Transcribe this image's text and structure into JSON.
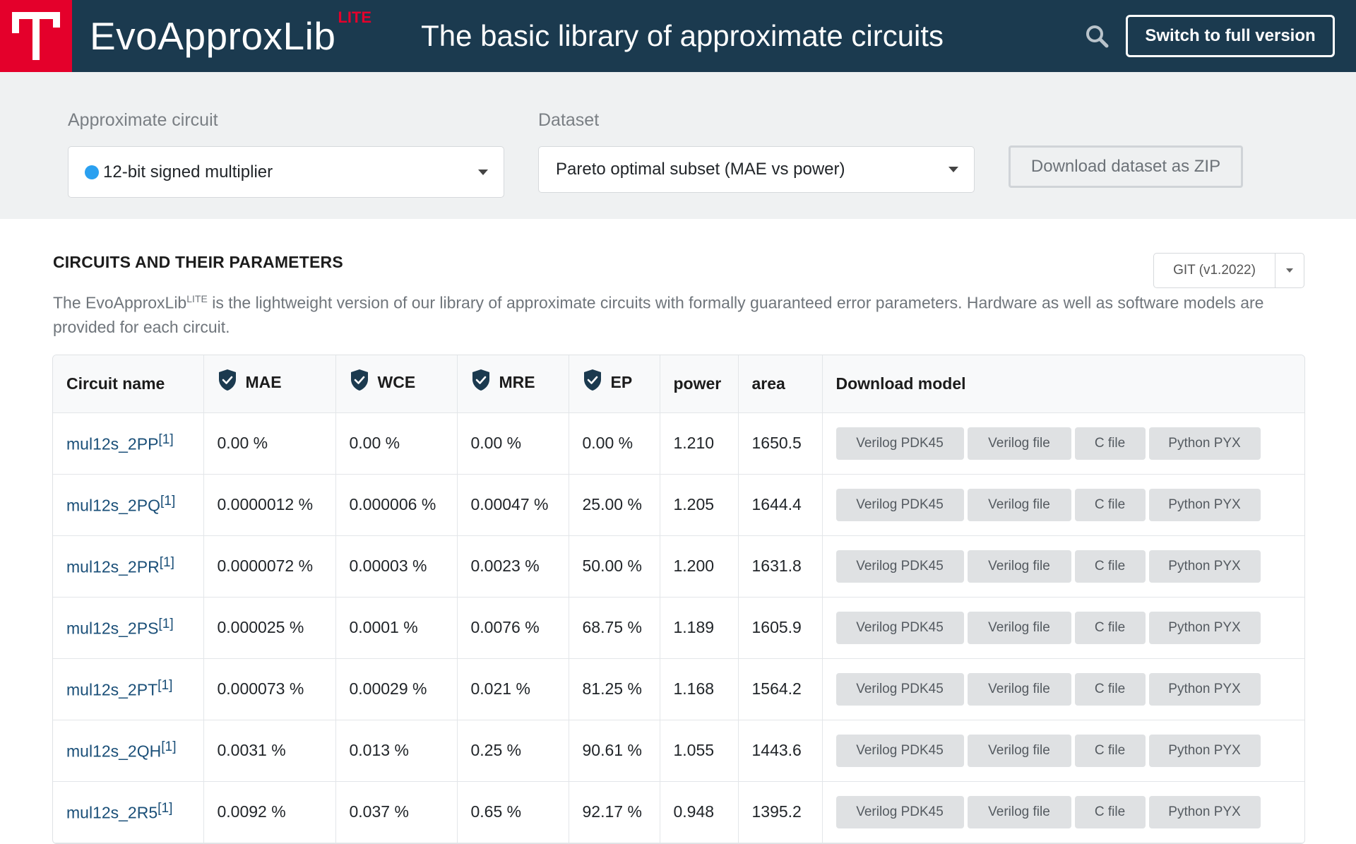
{
  "header": {
    "brand": "EvoApproxLib",
    "brand_sup": "LITE",
    "tagline": "The basic library of approximate circuits",
    "switch_label": "Switch to full version"
  },
  "filters": {
    "circuit_label": "Approximate circuit",
    "circuit_value": "12-bit signed multiplier",
    "circuit_dot_color": "#2aa0f0",
    "dataset_label": "Dataset",
    "dataset_value": "Pareto optimal subset (MAE vs power)",
    "download_zip_label": "Download dataset as ZIP"
  },
  "section": {
    "title": "CIRCUITS AND THEIR PARAMETERS",
    "version_label": "GIT (v1.2022)",
    "intro_pre": "The EvoApproxLib",
    "intro_sup": "LITE",
    "intro_post": " is the lightweight version of our library of approximate circuits with formally guaranteed error parameters. Hardware as well as software models are provided for each circuit."
  },
  "table": {
    "headers": {
      "name": "Circuit name",
      "mae": "MAE",
      "wce": "WCE",
      "mre": "MRE",
      "ep": "EP",
      "power": "power",
      "area": "area",
      "download": "Download model"
    },
    "buttons": {
      "verilog_pdk": "Verilog PDK45",
      "verilog": "Verilog file",
      "c": "C file",
      "python": "Python PYX"
    },
    "rows": [
      {
        "name": "mul12s_2PP",
        "ref": "[1]",
        "mae": "0.00 %",
        "wce": "0.00 %",
        "mre": "0.00 %",
        "ep": "0.00 %",
        "power": "1.210",
        "area": "1650.5"
      },
      {
        "name": "mul12s_2PQ",
        "ref": "[1]",
        "mae": "0.0000012 %",
        "wce": "0.000006 %",
        "mre": "0.00047 %",
        "ep": "25.00 %",
        "power": "1.205",
        "area": "1644.4"
      },
      {
        "name": "mul12s_2PR",
        "ref": "[1]",
        "mae": "0.0000072 %",
        "wce": "0.00003 %",
        "mre": "0.0023 %",
        "ep": "50.00 %",
        "power": "1.200",
        "area": "1631.8"
      },
      {
        "name": "mul12s_2PS",
        "ref": "[1]",
        "mae": "0.000025 %",
        "wce": "0.0001 %",
        "mre": "0.0076 %",
        "ep": "68.75 %",
        "power": "1.189",
        "area": "1605.9"
      },
      {
        "name": "mul12s_2PT",
        "ref": "[1]",
        "mae": "0.000073 %",
        "wce": "0.00029 %",
        "mre": "0.021 %",
        "ep": "81.25 %",
        "power": "1.168",
        "area": "1564.2"
      },
      {
        "name": "mul12s_2QH",
        "ref": "[1]",
        "mae": "0.0031 %",
        "wce": "0.013 %",
        "mre": "0.25 %",
        "ep": "90.61 %",
        "power": "1.055",
        "area": "1443.6"
      },
      {
        "name": "mul12s_2R5",
        "ref": "[1]",
        "mae": "0.0092 %",
        "wce": "0.037 %",
        "mre": "0.65 %",
        "ep": "92.17 %",
        "power": "0.948",
        "area": "1395.2"
      }
    ]
  },
  "colors": {
    "header_bg": "#1b3a4f",
    "logo_red": "#e4002b",
    "link": "#1a4f78"
  },
  "icons": [
    "logo-t-icon",
    "search-icon",
    "shield-check-icon",
    "caret-down-icon"
  ]
}
